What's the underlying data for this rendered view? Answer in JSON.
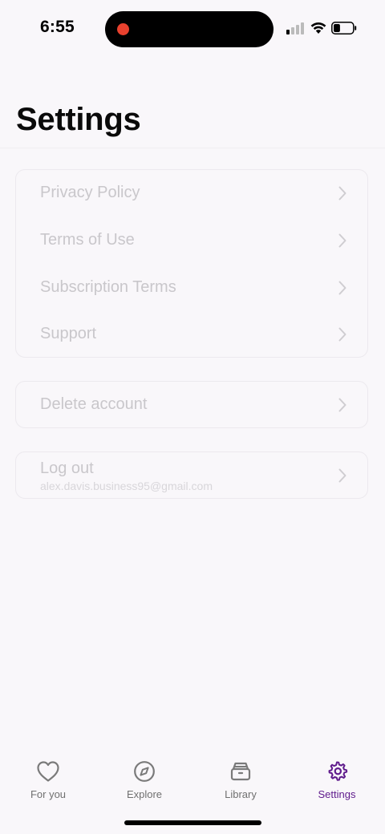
{
  "status_bar": {
    "time": "6:55",
    "recording_indicator_color": "#e8412e",
    "signal_icon": "cellular-signal-icon",
    "wifi_icon": "wifi-icon",
    "battery_icon": "battery-icon",
    "battery_level": 0.35
  },
  "header": {
    "title": "Settings"
  },
  "sections": [
    {
      "rows": [
        {
          "label": "Privacy Policy",
          "icon": "chevron-right-icon"
        },
        {
          "label": "Terms of Use",
          "icon": "chevron-right-icon"
        },
        {
          "label": "Subscription Terms",
          "icon": "chevron-right-icon"
        },
        {
          "label": "Support",
          "icon": "chevron-right-icon"
        }
      ]
    },
    {
      "rows": [
        {
          "label": "Delete account",
          "icon": "chevron-right-icon"
        }
      ]
    },
    {
      "rows": [
        {
          "label": "Log out",
          "sublabel": "alex.davis.business95@gmail.com",
          "icon": "chevron-right-icon"
        }
      ]
    }
  ],
  "tabbar": {
    "tabs": [
      {
        "label": "For you",
        "icon": "heart-icon",
        "active": false
      },
      {
        "label": "Explore",
        "icon": "compass-icon",
        "active": false
      },
      {
        "label": "Library",
        "icon": "archive-box-icon",
        "active": false
      },
      {
        "label": "Settings",
        "icon": "gear-icon",
        "active": true
      }
    ],
    "active_color": "#5f1b8c",
    "inactive_color": "#707070"
  }
}
